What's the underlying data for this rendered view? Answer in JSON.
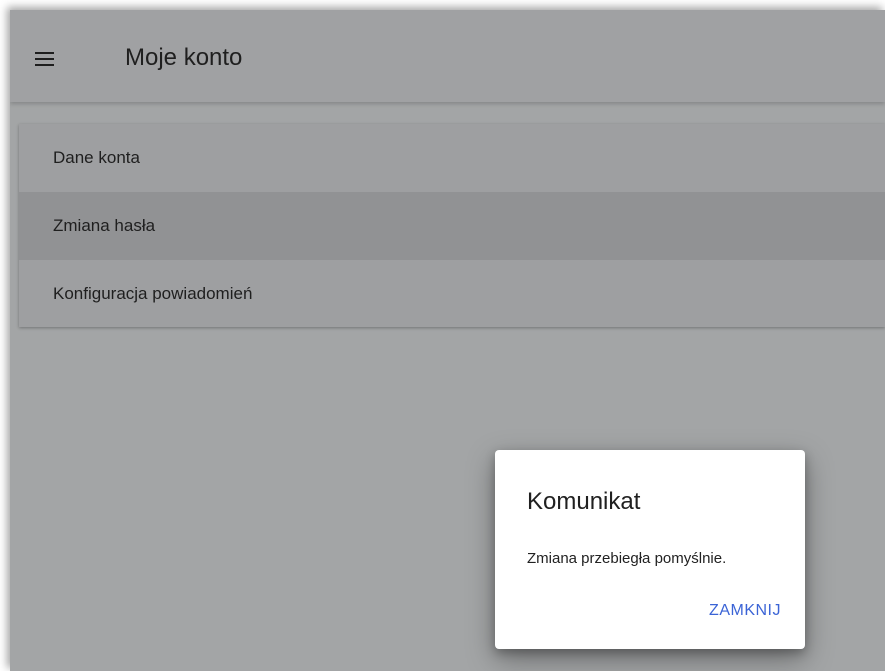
{
  "app": {
    "title": "Moje konto"
  },
  "icons": {
    "menu": "hamburger-menu-icon"
  },
  "colors": {
    "accent": "#3b64d6",
    "dialog_background": "#ffffff",
    "scrim": "#a3a5a6"
  },
  "menu": {
    "items": [
      {
        "label": "Dane konta",
        "selected": false
      },
      {
        "label": "Zmiana hasła",
        "selected": true
      },
      {
        "label": "Konfiguracja powiadomień",
        "selected": false
      }
    ]
  },
  "dialog": {
    "title": "Komunikat",
    "message": "Zmiana przebiegła pomyślnie.",
    "close_label": "ZAMKNIJ"
  }
}
